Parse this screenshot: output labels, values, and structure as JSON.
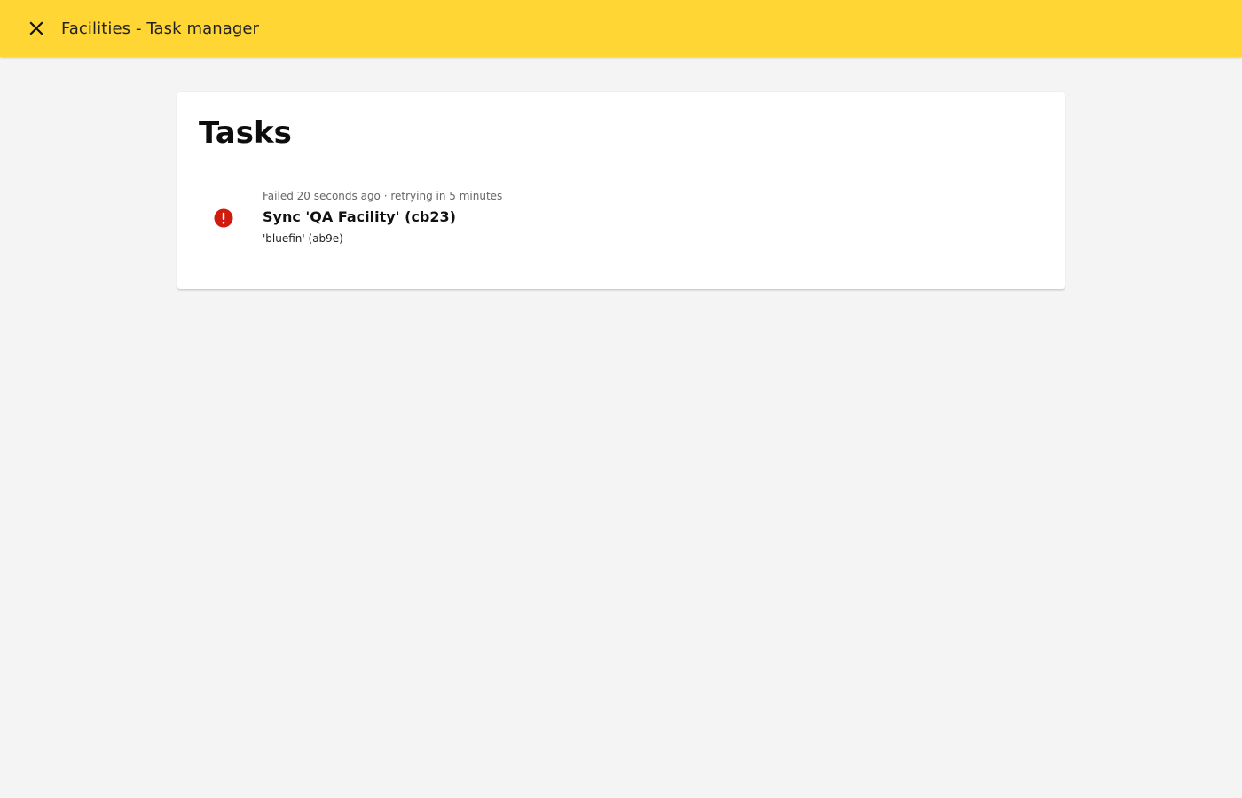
{
  "app_bar": {
    "title": "Facilities - Task manager",
    "close_icon": "close-icon",
    "background_color": "#ffd633"
  },
  "tasks_card": {
    "title": "Tasks",
    "tasks": [
      {
        "status": "failed",
        "status_icon": "error-icon",
        "status_color": "#d01c0e",
        "meta": "Failed 20 seconds ago · retrying in 5 minutes",
        "title": "Sync 'QA Facility' (cb23)",
        "subtitle": "'bluefin' (ab9e)"
      }
    ]
  }
}
